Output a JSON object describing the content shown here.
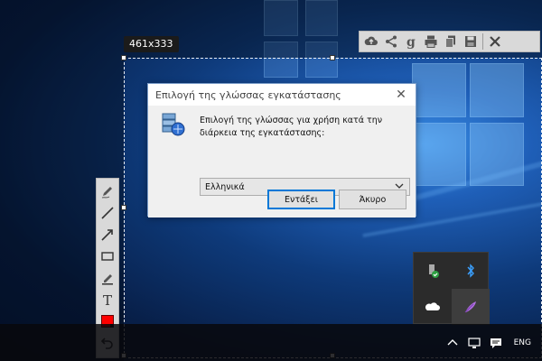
{
  "capture": {
    "size_label": "461x333"
  },
  "top_toolbar": {
    "buttons": [
      "upload-cloud-icon",
      "share-icon",
      "google-search-icon",
      "print-icon",
      "copy-icon",
      "save-icon",
      "close-icon"
    ]
  },
  "left_toolbar": {
    "tools": [
      "pen-icon",
      "line-icon",
      "arrow-icon",
      "rectangle-icon",
      "marker-icon",
      "text-icon",
      "color-swatch",
      "undo-icon"
    ],
    "color": "#ff0000"
  },
  "dialog": {
    "title": "Επιλογή της γλώσσας εγκατάστασης",
    "message": "Επιλογή της γλώσσας για χρήση κατά την διάρκεια της εγκατάστασης:",
    "selected_language": "Ελληνικά",
    "ok_label": "Εντάξει",
    "cancel_label": "Άκυρο"
  },
  "taskbar": {
    "language": "ENG"
  },
  "colors": {
    "accent": "#0078d7",
    "taskbar": "#0b0b10"
  }
}
